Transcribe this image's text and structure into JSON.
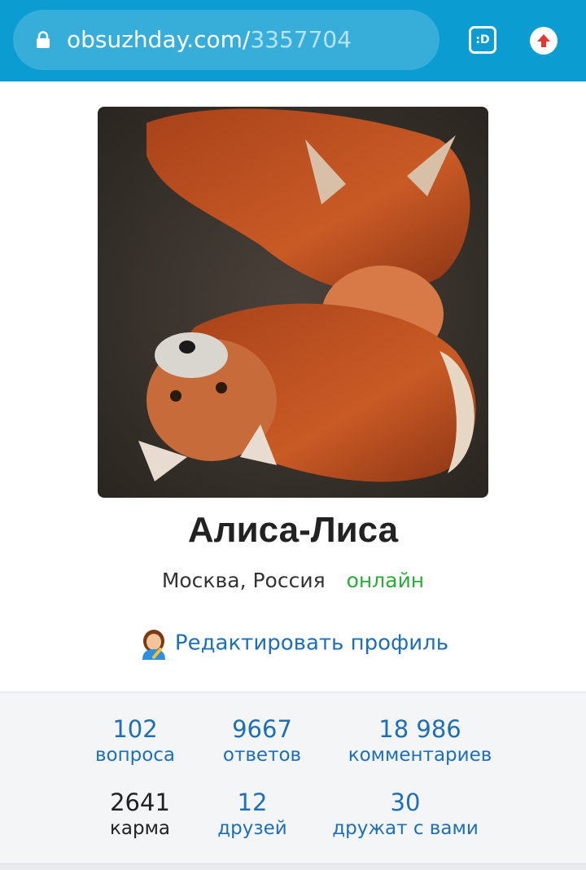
{
  "browser": {
    "url_domain": "obsuzhday.com/",
    "url_path": "3357704",
    "smiley_label": ":D",
    "accent": "#0b9cd2"
  },
  "profile": {
    "name": "Алиса-Лиса",
    "location": "Москва, Россия",
    "status": "онлайн",
    "status_color": "#2eaa3a",
    "edit_label": "Редактировать профиль",
    "avatar_icon": "fox-photo"
  },
  "stats": [
    {
      "value": "102",
      "label": "вопроса"
    },
    {
      "value": "9667",
      "label": "ответов"
    },
    {
      "value": "18 986",
      "label": "комментариев"
    },
    {
      "value": "2641",
      "label": "карма"
    },
    {
      "value": "12",
      "label": "друзей"
    },
    {
      "value": "30",
      "label": "дружат с вами"
    }
  ]
}
